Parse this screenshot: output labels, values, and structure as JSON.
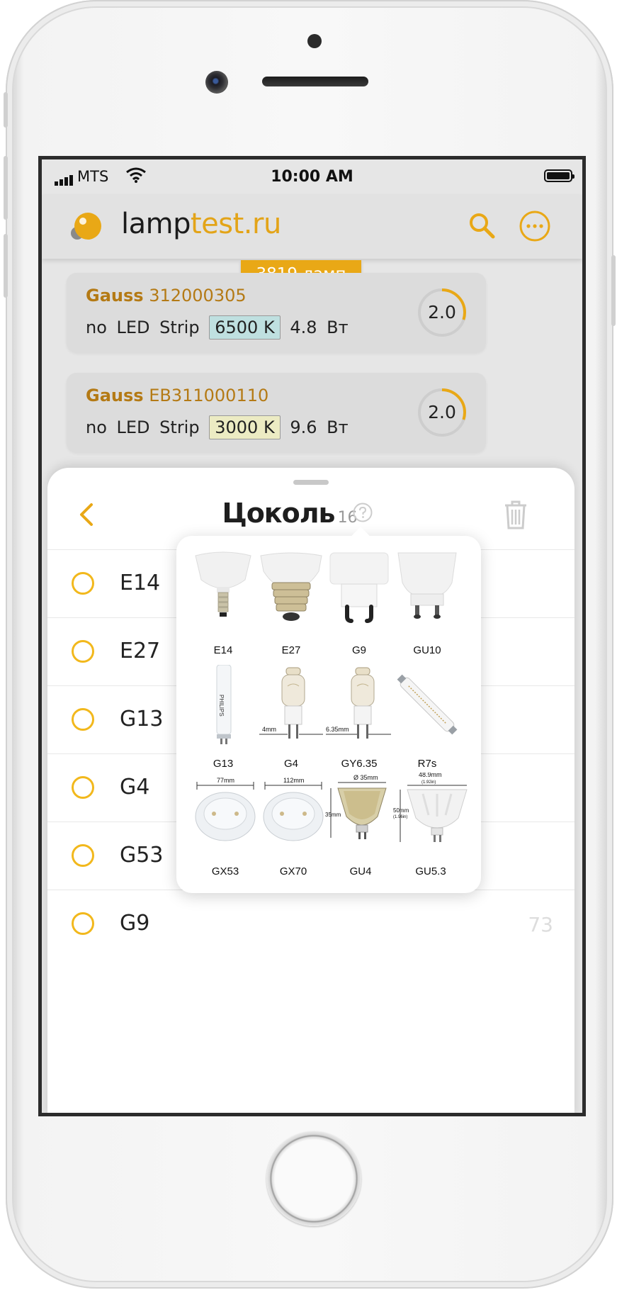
{
  "status_bar": {
    "carrier": "MTS",
    "time": "10:00 AM"
  },
  "app_bar": {
    "logo_part1": "lamp",
    "logo_part2": "test.ru"
  },
  "results": {
    "count_label": "3819 ламп"
  },
  "cards": [
    {
      "brand": "Gauss",
      "model": "312000305",
      "specs": "no LED Strip",
      "color_temp": "6500 K",
      "temp_color": "#bfe0e0",
      "power": "4.8 Вт",
      "rating": "2.0",
      "rating_fraction": 0.3
    },
    {
      "brand": "Gauss",
      "model": "EB311000110",
      "specs": "no LED Strip",
      "color_temp": "3000 K",
      "temp_color": "#ecebc3",
      "power": "9.6 Вт",
      "rating": "2.0",
      "rating_fraction": 0.3
    }
  ],
  "filter_sheet": {
    "title": "Цоколь",
    "count": "16",
    "options": [
      {
        "label": "E14",
        "count": ""
      },
      {
        "label": "E27",
        "count": ""
      },
      {
        "label": "G13",
        "count": ""
      },
      {
        "label": "G4",
        "count": ""
      },
      {
        "label": "G53",
        "count": ""
      },
      {
        "label": "G9",
        "count": "73"
      }
    ]
  },
  "base_popup": {
    "bases": [
      {
        "name": "E14"
      },
      {
        "name": "E27"
      },
      {
        "name": "G9"
      },
      {
        "name": "GU10"
      },
      {
        "name": "G13"
      },
      {
        "name": "G4",
        "dim": "4mm"
      },
      {
        "name": "GY6.35",
        "dim": "6.35mm"
      },
      {
        "name": "R7s"
      },
      {
        "name": "GX53",
        "dim": "77mm"
      },
      {
        "name": "GX70",
        "dim": "112mm"
      },
      {
        "name": "GU4",
        "dim": "Ø 35mm",
        "dim2": "35mm"
      },
      {
        "name": "GU5.3",
        "dim": "48.9mm",
        "dim_sub": "(1.92in)",
        "dim2": "50mm",
        "dim2_sub": "(1.96in)"
      }
    ],
    "tube_brand": "PHILIPS"
  },
  "colors": {
    "accent": "#e9a816",
    "brand_text": "#b47a15",
    "radio": "#f2b81c"
  }
}
